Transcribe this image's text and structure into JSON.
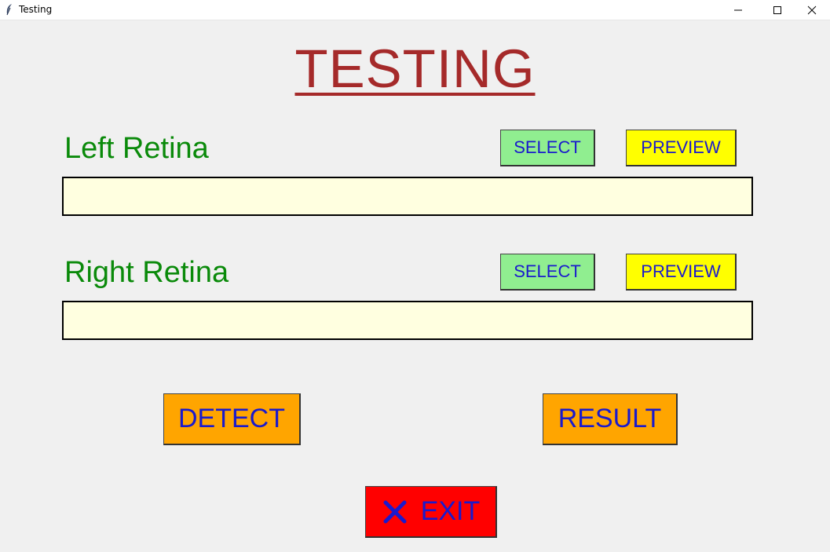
{
  "window": {
    "title": "Testing"
  },
  "page": {
    "heading": "TESTING"
  },
  "left": {
    "label": "Left Retina",
    "select_label": "SELECT",
    "preview_label": "PREVIEW",
    "path_value": ""
  },
  "right": {
    "label": "Right Retina",
    "select_label": "SELECT",
    "preview_label": "PREVIEW",
    "path_value": ""
  },
  "actions": {
    "detect_label": "DETECT",
    "result_label": "RESULT",
    "exit_label": "EXIT"
  },
  "icons": {
    "app": "feather-icon",
    "minimize": "minimize-icon",
    "maximize": "maximize-icon",
    "close": "close-icon",
    "exit": "x-icon"
  },
  "colors": {
    "heading": "#a52a2a",
    "label": "#0a8a0a",
    "select_bg": "#90ee90",
    "preview_bg": "#ffff00",
    "action_bg": "#ffa500",
    "exit_bg": "#ff0000",
    "button_text": "#1a1acd",
    "field_bg": "#ffffe0"
  }
}
